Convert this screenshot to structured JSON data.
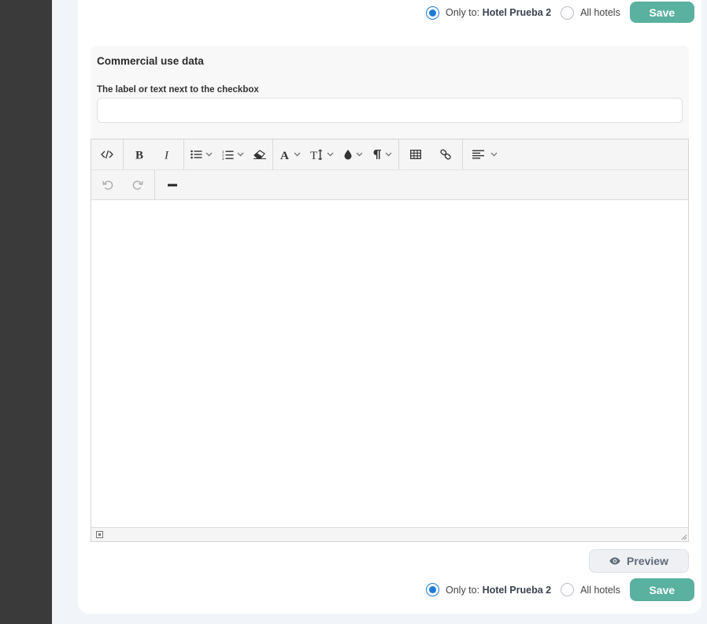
{
  "scope": {
    "only_to_prefix": "Only to:",
    "hotel_name": "Hotel Prueba 2",
    "all_hotels": "All hotels"
  },
  "save_label": "Save",
  "commercial_use": {
    "title": "Commercial use data",
    "label_caption": "The label or text next to the checkbox",
    "label_value": ""
  },
  "editor": {
    "content": ""
  },
  "preview_label": "Preview",
  "colors": {
    "sidebar": "#3a3a3a",
    "save_button": "#5ab1a0",
    "radio_checked": "#1e7ad6"
  }
}
